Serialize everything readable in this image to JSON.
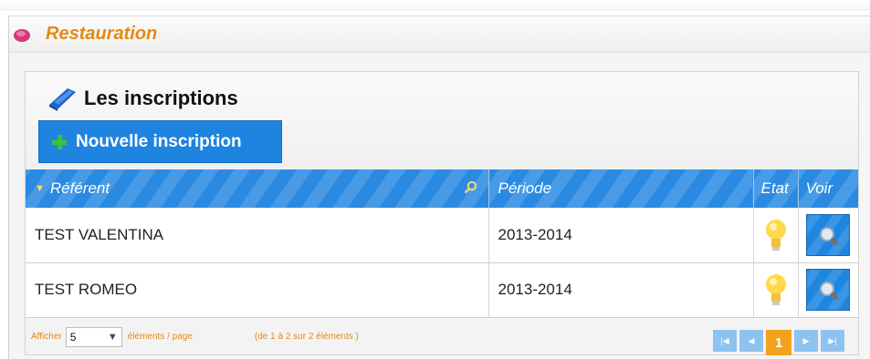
{
  "app": {
    "title": "Restauration",
    "icon": "app-icon"
  },
  "panel": {
    "title": "Les inscriptions",
    "title_icon": "book-icon",
    "new_button": {
      "label": "Nouvelle inscription",
      "icon": "plus-icon"
    }
  },
  "table": {
    "columns": {
      "referent": "Référent",
      "periode": "Période",
      "etat": "Etat",
      "voir": "Voir"
    },
    "rows": [
      {
        "referent": "TEST VALENTINA",
        "periode": "2013-2014",
        "etat_icon": "lightbulb-icon",
        "voir_icon": "magnifier-icon"
      },
      {
        "referent": "TEST ROMEO",
        "periode": "2013-2014",
        "etat_icon": "lightbulb-icon",
        "voir_icon": "magnifier-icon"
      }
    ]
  },
  "footer": {
    "afficher": "Afficher",
    "page_size": "5",
    "elements_page": "éléments / page",
    "range_info": "(de 1 à 2 sur 2 éléments )",
    "current_page": "1"
  },
  "colors": {
    "accent_orange": "#e48a12",
    "header_blue": "#2a8ae2",
    "button_blue": "#1e84df",
    "pager_current": "#f4a11b"
  }
}
